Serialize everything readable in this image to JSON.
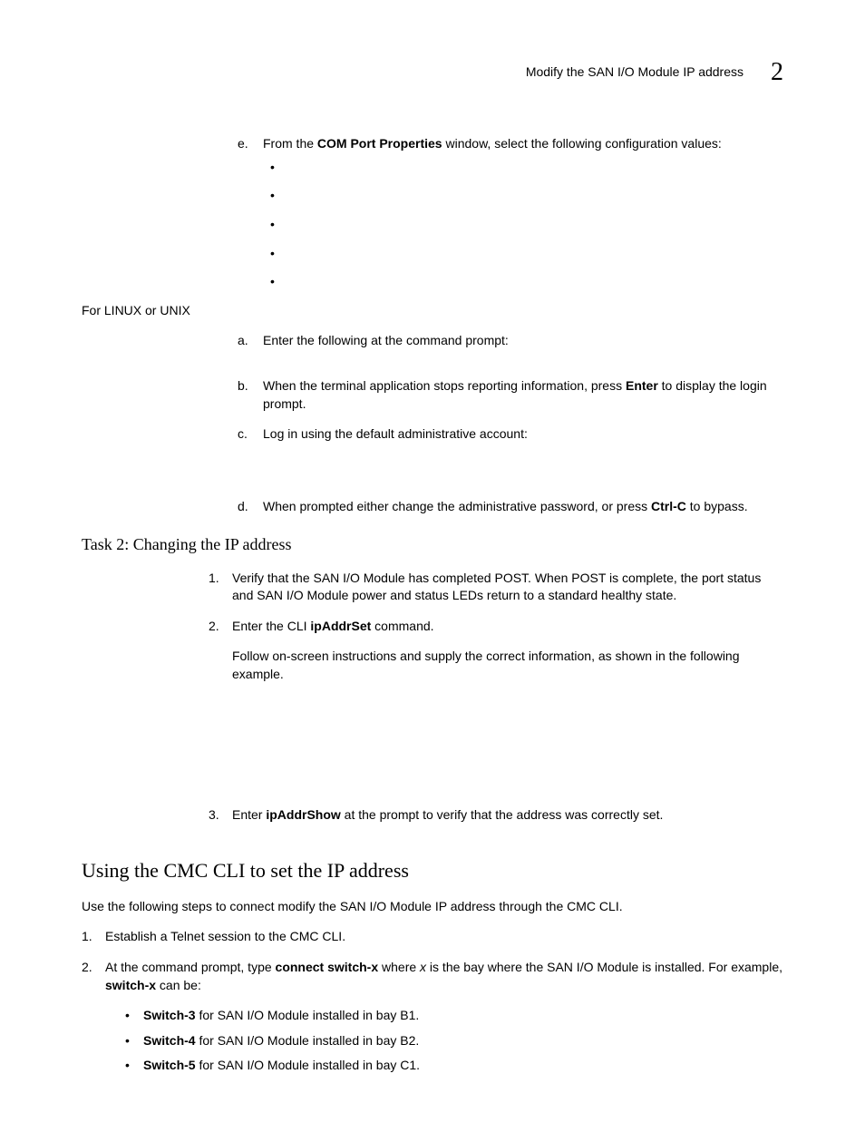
{
  "header": {
    "title": "Modify the SAN I/O Module IP address",
    "chapter": "2"
  },
  "step_e": {
    "marker": "e.",
    "pre": "From the ",
    "bold": "COM Port Properties",
    "post": " window, select the following configuration values:"
  },
  "linux_intro": "For LINUX or UNIX",
  "linux_a": {
    "marker": "a.",
    "text": "Enter the following at the command prompt:"
  },
  "linux_b": {
    "marker": "b.",
    "pre": "When the terminal application stops reporting information, press ",
    "bold": "Enter",
    "post": " to display the login prompt."
  },
  "linux_c": {
    "marker": "c.",
    "text": "Log in using the default administrative account:"
  },
  "linux_d": {
    "marker": "d.",
    "pre": "When prompted either change the administrative password, or press ",
    "bold": "Ctrl-C",
    "post": " to bypass."
  },
  "task2_heading": "Task 2: Changing the IP address",
  "task2_1": {
    "marker": "1.",
    "text": "Verify that the SAN I/O Module has completed POST. When POST is complete, the port status and SAN I/O Module power and status LEDs return to a standard healthy state."
  },
  "task2_2": {
    "marker": "2.",
    "pre": "Enter the CLI ",
    "bold": "ipAddrSet",
    "post": " command."
  },
  "task2_2_follow": "Follow on-screen instructions and supply the correct information, as shown in the following example.",
  "task2_3": {
    "marker": "3.",
    "pre": "Enter ",
    "bold": "ipAddrShow",
    "post": " at the prompt to verify that the address was correctly set."
  },
  "cmc_heading": "Using the CMC CLI to set the IP address",
  "cmc_intro": "Use the following steps to connect modify the SAN I/O Module IP address through the CMC CLI.",
  "cmc_1": {
    "marker": "1.",
    "text": "Establish a Telnet session to the CMC CLI."
  },
  "cmc_2": {
    "marker": "2.",
    "p1": "At the command prompt, type ",
    "b1": "connect switch-x",
    "p2": " where ",
    "i1": "x",
    "p3": " is the bay where the SAN I/O Module is installed. For example, ",
    "b2": "switch-x",
    "p4": " can be:"
  },
  "sw3": {
    "b": "Switch-3",
    "t": " for SAN I/O Module installed in bay B1."
  },
  "sw4": {
    "b": "Switch-4",
    "t": " for SAN I/O Module installed in bay B2."
  },
  "sw5": {
    "b": "Switch-5",
    "t": " for SAN I/O Module installed in bay C1."
  }
}
